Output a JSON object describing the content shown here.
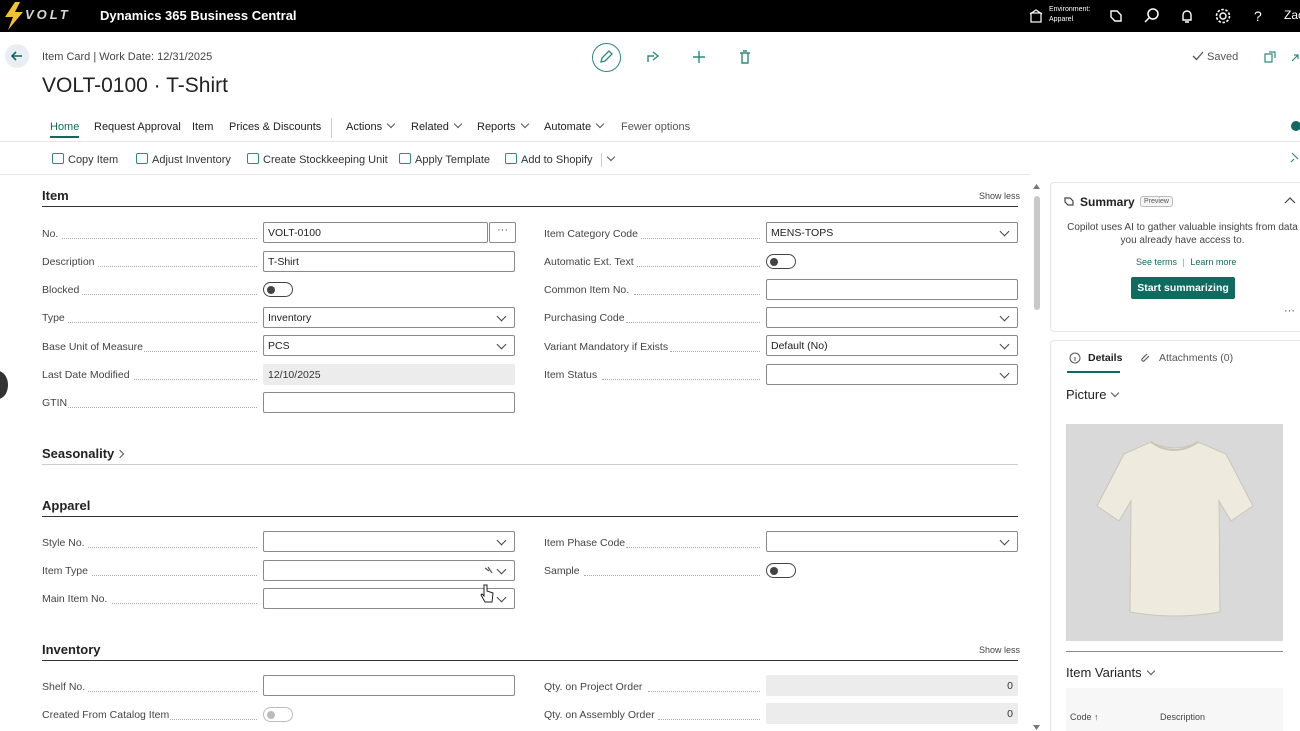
{
  "topbar": {
    "logo_text": "VOLT",
    "app_title": "Dynamics 365 Business Central",
    "env_label": "Environment:",
    "env_value": "Apparel",
    "user": "Zac"
  },
  "page": {
    "breadcrumb": "Item Card | Work Date: 12/31/2025",
    "title": "VOLT-0100 · T-Shirt",
    "saved": "Saved"
  },
  "nav": {
    "items": [
      "Home",
      "Request Approval",
      "Item",
      "Prices & Discounts",
      "Actions",
      "Related",
      "Reports",
      "Automate",
      "Fewer options"
    ]
  },
  "tools": {
    "items": [
      "Copy Item",
      "Adjust Inventory",
      "Create Stockkeeping Unit",
      "Apply Template",
      "Add to Shopify"
    ]
  },
  "item_section": {
    "title": "Item",
    "show_less": "Show less",
    "fields": {
      "no_label": "No.",
      "no_value": "VOLT-0100",
      "ellipsis": "···",
      "desc_label": "Description",
      "desc_value": "T-Shirt",
      "blocked_label": "Blocked",
      "type_label": "Type",
      "type_value": "Inventory",
      "buom_label": "Base Unit of Measure",
      "buom_value": "PCS",
      "ldm_label": "Last Date Modified",
      "ldm_value": "12/10/2025",
      "gtin_label": "GTIN",
      "gtin_value": "",
      "icc_label": "Item Category Code",
      "icc_value": "MENS-TOPS",
      "aet_label": "Automatic Ext. Text",
      "cin_label": "Common Item No.",
      "cin_value": "",
      "pc_label": "Purchasing Code",
      "pc_value": "",
      "vm_label": "Variant Mandatory if Exists",
      "vm_value": "Default (No)",
      "is_label": "Item Status",
      "is_value": ""
    }
  },
  "seasonality": {
    "title": "Seasonality"
  },
  "apparel": {
    "title": "Apparel",
    "style_label": "Style No.",
    "style_value": "",
    "itype_label": "Item Type",
    "itype_value": "",
    "main_label": "Main Item No.",
    "main_value": "",
    "phase_label": "Item Phase Code",
    "phase_value": "",
    "sample_label": "Sample"
  },
  "inventory": {
    "title": "Inventory",
    "show_less": "Show less",
    "shelf_label": "Shelf No.",
    "shelf_value": "",
    "cfc_label": "Created From Catalog Item",
    "qpo_label": "Qty. on Project Order",
    "qpo_value": "0",
    "qao_label": "Qty. on Assembly Order",
    "qao_value": "0"
  },
  "copilot": {
    "title": "Summary",
    "badge": "Preview",
    "text": "Copilot uses AI to gather valuable insights from data you already have access to.",
    "see_terms": "See terms",
    "sep": "|",
    "learn_more": "Learn more",
    "button": "Start summarizing",
    "more": "···"
  },
  "factbox": {
    "tab_details": "Details",
    "tab_attachments": "Attachments (0)",
    "picture_title": "Picture",
    "variants_title": "Item Variants",
    "col_code": "Code ↑",
    "col_desc": "Description"
  },
  "colors": {
    "accent": "#0f6b5f",
    "topbar": "#000000"
  }
}
